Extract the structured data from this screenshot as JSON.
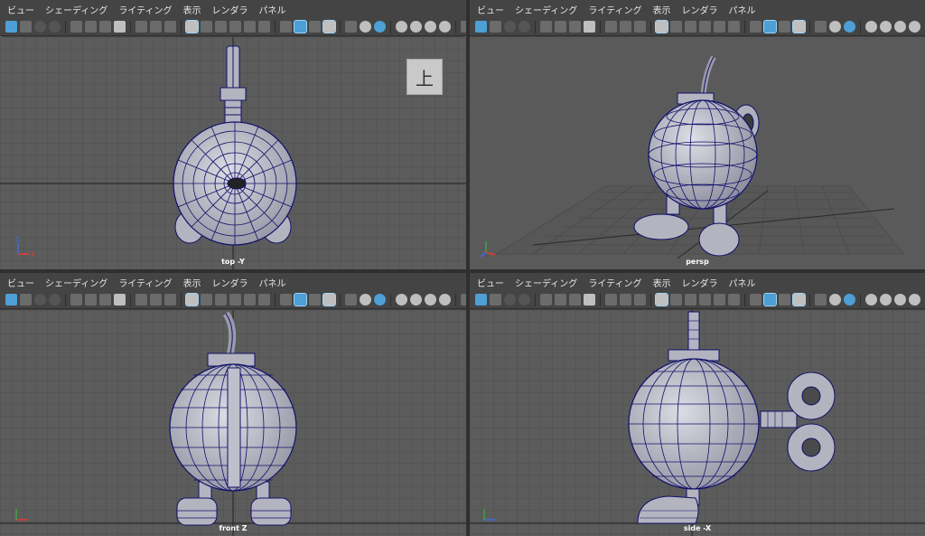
{
  "menu": [
    "ビュー",
    "シェーディング",
    "ライティング",
    "表示",
    "レンダラ",
    "パネル"
  ],
  "views": {
    "top": {
      "label": "top -Y",
      "cube_label": "上"
    },
    "persp": {
      "label": "persp"
    },
    "front": {
      "label": "front Z"
    },
    "side": {
      "label": "side -X"
    }
  },
  "colors": {
    "accent": "#4d9fd6",
    "viewport_bg": "#5c5c5c",
    "wire": "#0a0a6a",
    "mesh": "#b8b8c4"
  }
}
